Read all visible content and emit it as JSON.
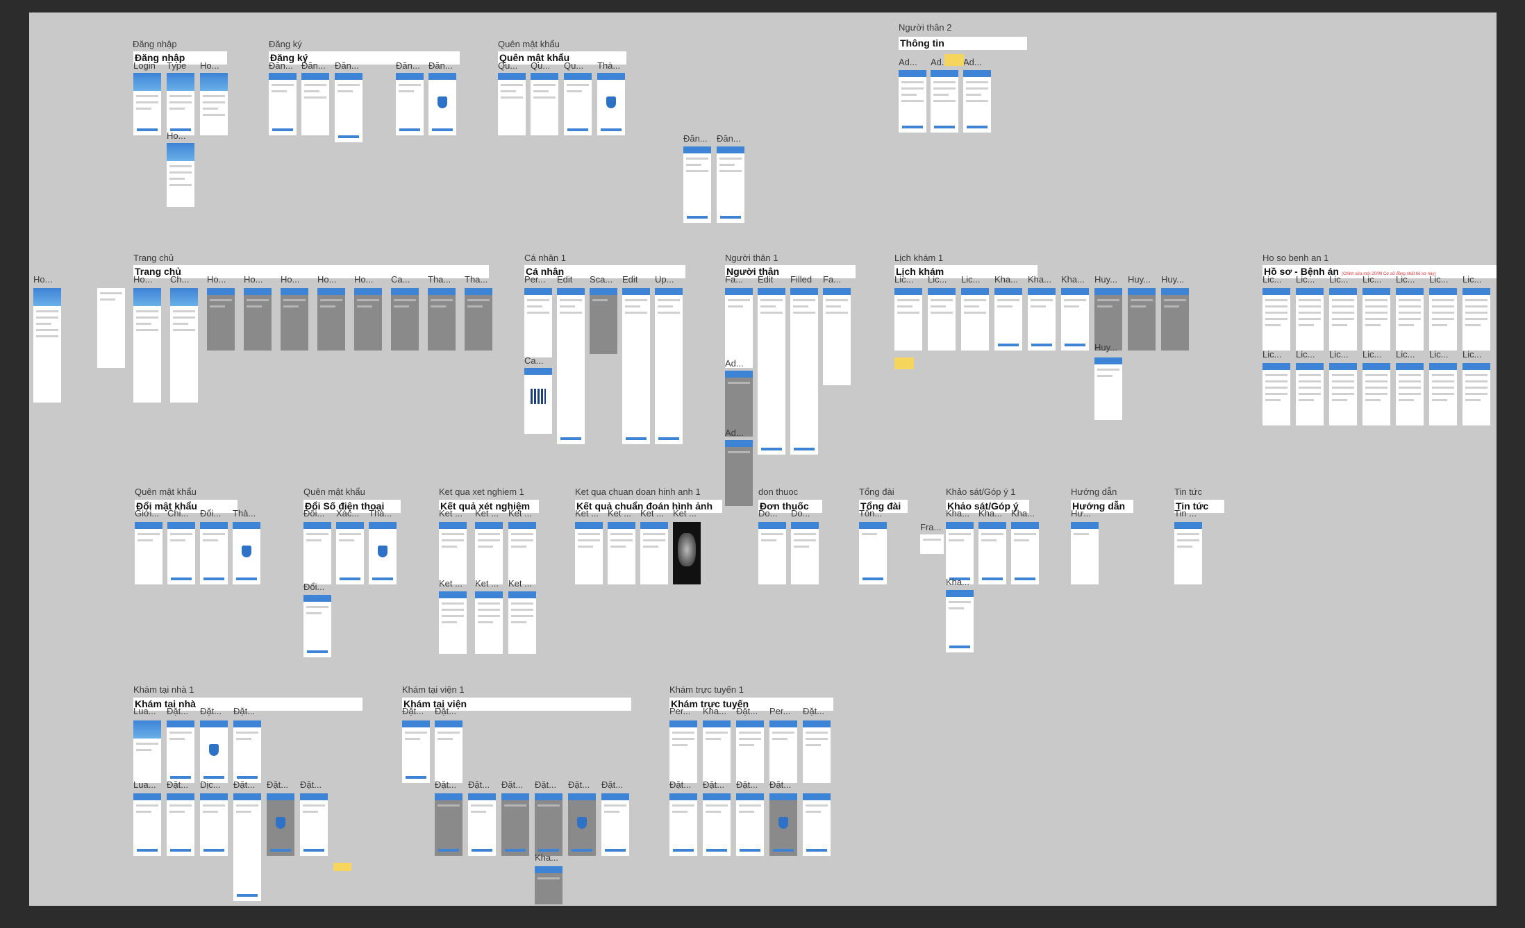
{
  "sections": [
    {
      "label": "Đăng nhập",
      "bar": "Đăng nhập"
    },
    {
      "label": "Đăng ký",
      "bar": "Đăng ký"
    },
    {
      "label": "Quên mật khẩu",
      "bar": "Quên mật khẩu"
    },
    {
      "label": "Người thân 2",
      "bar": "Thông tin"
    },
    {
      "label": "Trang chủ",
      "bar": "Trang chủ"
    },
    {
      "label": "Cá nhân 1",
      "bar": "Cá nhân"
    },
    {
      "label": "Người thân 1",
      "bar": "Người thân"
    },
    {
      "label": "Lịch khám 1",
      "bar": "Lịch khám"
    },
    {
      "label": "Ho so benh an 1",
      "bar": "Hồ sơ - Bệnh án",
      "note": "(Chỉnh sửa mới 20/09 Cơ sở đồng nhất hồ sơ này)"
    },
    {
      "label": "Quên mật khẩu",
      "bar": "Đổi mật khẩu"
    },
    {
      "label": "Quên mật khẩu",
      "bar": "Đổi Số điện thoại"
    },
    {
      "label": "Ket qua xet nghiem 1",
      "bar": "Kết quả xét nghiệm"
    },
    {
      "label": "Ket qua chuan doan hinh anh 1",
      "bar": "Kết quả chuẩn đoán hình ảnh"
    },
    {
      "label": "don thuoc",
      "bar": "Đơn thuốc"
    },
    {
      "label": "Tổng đài",
      "bar": "Tổng đài"
    },
    {
      "label": "Khảo sát/Góp ý 1",
      "bar": "Khảo sát/Góp ý"
    },
    {
      "label": "Hướng dẫn",
      "bar": "Hướng dẫn"
    },
    {
      "label": "Tin tức",
      "bar": "Tin tức"
    },
    {
      "label": "Khám tại nhà 1",
      "bar": "Khám tại nhà"
    },
    {
      "label": "Khám tại viện 1",
      "bar": "Khám tại viện"
    },
    {
      "label": "Khám trực tuyến 1",
      "bar": "Khám trực tuyến"
    }
  ],
  "frame_labels": [
    "Login",
    "Type",
    "Ho...",
    "Ho...",
    "Đăn...",
    "Đăn...",
    "Đăn...",
    "Đăn...",
    "Đăn...",
    "Qu...",
    "Qu...",
    "Qu...",
    "Thà...",
    "Ad...",
    "Ad...",
    "Ad...",
    "Đăn...",
    "Đăn...",
    "Ho...",
    "Ho...",
    "Ch...",
    "Ho...",
    "Ho...",
    "Ho...",
    "Ho...",
    "Ho...",
    "Ca...",
    "Tha...",
    "Tha...",
    "Per...",
    "Edit",
    "Sca...",
    "Edit",
    "Up...",
    "Ca...",
    "Fa...",
    "Edit",
    "Filled",
    "Fa...",
    "Ad...",
    "Ad...",
    "Lic...",
    "Lic...",
    "Lic...",
    "Kha...",
    "Kha...",
    "Kha...",
    "Huy...",
    "Huy...",
    "Huy...",
    "Huy...",
    "Lic...",
    "Lic...",
    "Lic...",
    "Lic...",
    "Lic...",
    "Lic...",
    "Lic...",
    "Lic...",
    "Lic...",
    "Lic...",
    "Lic...",
    "Lic...",
    "Lic...",
    "Lic...",
    "Giới...",
    "Chi...",
    "Đổi...",
    "Thà...",
    "Đổi...",
    "Xác...",
    "Thà...",
    "Đổi...",
    "Ket ...",
    "Ket ...",
    "Ket ...",
    "Ket ...",
    "Ket ...",
    "Ket ...",
    "Ket ...",
    "Ket ...",
    "Ket ...",
    "Ket ...",
    "Do...",
    "Do...",
    "Tổn...",
    "Kha...",
    "Kha...",
    "Kha...",
    "Fra...",
    "Kha...",
    "Hư...",
    "Tin ...",
    "Lua...",
    "Đặt...",
    "Đặt...",
    "Đặt...",
    "Lua...",
    "Đặt...",
    "Dịc...",
    "Đặt...",
    "Đặt...",
    "Đặt...",
    "Đặt...",
    "Đặt...",
    "Đặt...",
    "Đặt...",
    "Đặt...",
    "Đặt...",
    "Đặt...",
    "Đặt...",
    "Kha...",
    "Per...",
    "Kha...",
    "Đặt...",
    "Per...",
    "Đặt...",
    "Đặt...",
    "Đặt...",
    "Đặt...",
    "Đặt..."
  ]
}
